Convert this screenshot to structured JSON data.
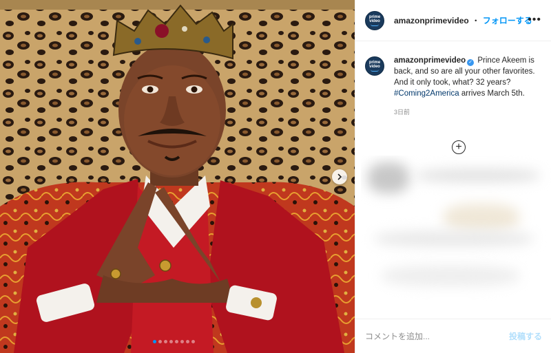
{
  "account": {
    "username": "amazonprimevideo",
    "avatar_text_top": "prime",
    "avatar_text_bottom": "video"
  },
  "header": {
    "separator": "・",
    "follow_label": "フォローする",
    "more_label": "•••"
  },
  "caption": {
    "username": "amazonprimevideo",
    "text": "Prince Akeem is back, and so are all your other favorites. And it only took, what? 32 years?",
    "hashtag": "#Coming2America",
    "text_after": "arrives March 5th.",
    "time": "3日前"
  },
  "load_more_label": "+",
  "comment": {
    "placeholder": "コメントを追加...",
    "post_label": "投稿する"
  },
  "carousel": {
    "total_slides": 8,
    "active_slide": 1
  },
  "colors": {
    "accent": "#0095f6",
    "post_disabled": "#b2dffc",
    "hashtag": "#00376b",
    "avatar_bg": "#1a3a5c"
  },
  "icons": {
    "next": "chevron-right-icon",
    "verified": "verified-badge-icon",
    "more": "more-options-icon",
    "load_more": "plus-circle-icon"
  }
}
